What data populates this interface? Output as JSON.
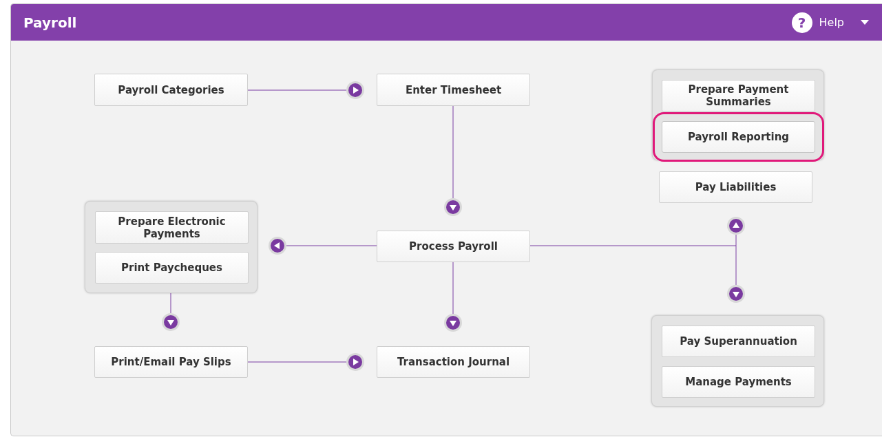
{
  "header": {
    "title": "Payroll",
    "help_glyph": "?",
    "help_label": "Help"
  },
  "nodes": [
    {
      "label": "Payroll Categories",
      "highlighted": false
    },
    {
      "label": "Enter Timesheet",
      "highlighted": false
    },
    {
      "label": "Prepare Payment Summaries",
      "highlighted": false
    },
    {
      "label": "Payroll Reporting",
      "highlighted": true
    },
    {
      "label": "Pay Liabilities",
      "highlighted": false
    },
    {
      "label": "Prepare Electronic Payments",
      "highlighted": false
    },
    {
      "label": "Print Paycheques",
      "highlighted": false
    },
    {
      "label": "Process Payroll",
      "highlighted": false
    },
    {
      "label": "Print/Email Pay Slips",
      "highlighted": false
    },
    {
      "label": "Transaction Journal",
      "highlighted": false
    },
    {
      "label": "Pay Superannuation",
      "highlighted": false
    },
    {
      "label": "Manage Payments",
      "highlighted": false
    }
  ]
}
